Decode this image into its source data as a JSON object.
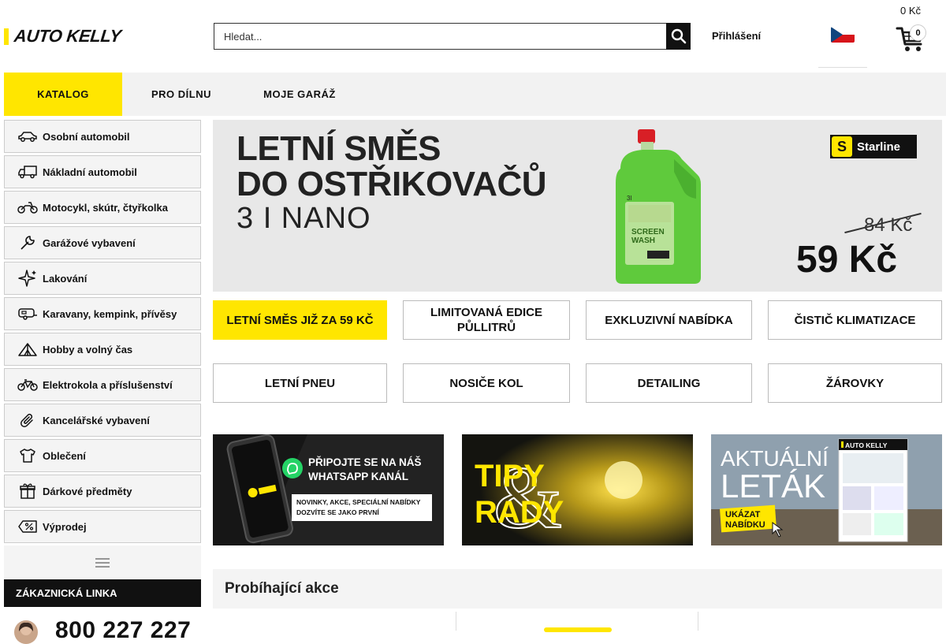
{
  "header": {
    "logo": "AUTO KELLY",
    "search_placeholder": "Hledat...",
    "login_label": "Přihlášení",
    "language_flag": "czech-flag-icon",
    "cart_price": "0 Kč",
    "cart_count": "0"
  },
  "nav": {
    "tabs": [
      {
        "label": "KATALOG",
        "active": true
      },
      {
        "label": "PRO DÍLNU",
        "active": false
      },
      {
        "label": "MOJE GARÁŽ",
        "active": false
      }
    ]
  },
  "sidebar": {
    "items": [
      {
        "label": "Osobní automobil",
        "icon": "car-icon"
      },
      {
        "label": "Nákladní automobil",
        "icon": "truck-icon"
      },
      {
        "label": "Motocykl, skútr, čtyřkolka",
        "icon": "motorcycle-icon"
      },
      {
        "label": "Garážové vybavení",
        "icon": "wrench-icon"
      },
      {
        "label": "Lakování",
        "icon": "sparkle-icon"
      },
      {
        "label": "Karavany, kempink, přívěsy",
        "icon": "caravan-icon"
      },
      {
        "label": "Hobby a volný čas",
        "icon": "tent-icon"
      },
      {
        "label": "Elektrokola a příslušenství",
        "icon": "bicycle-icon"
      },
      {
        "label": "Kancelářské vybavení",
        "icon": "paperclip-icon"
      },
      {
        "label": "Oblečení",
        "icon": "tshirt-icon"
      },
      {
        "label": "Dárkové předměty",
        "icon": "gift-icon"
      },
      {
        "label": "Výprodej",
        "icon": "percent-tag-icon"
      }
    ],
    "more_icon": "hamburger-menu-icon",
    "hotline_label": "ZÁKAZNICKÁ LINKA",
    "phone": "800 227 227"
  },
  "hero": {
    "title_line1": "LETNÍ SMĚS",
    "title_line2": "DO OSTŘIKOVAČŮ",
    "subtitle": "3 I NANO",
    "brand": "Starline",
    "brand_letter": "S",
    "old_price": "84 Kč",
    "new_price": "59 Kč",
    "bottle_label_1": "SCREEN",
    "bottle_label_2": "WASH",
    "bottle_volume": "3l"
  },
  "categories": [
    {
      "label": "LETNÍ SMĚS JIŽ ZA 59 KČ",
      "highlight": true
    },
    {
      "label": "LIMITOVANÁ EDICE PŮLLITRŮ",
      "highlight": false
    },
    {
      "label": "EXKLUZIVNÍ NABÍDKA",
      "highlight": false
    },
    {
      "label": "ČISTIČ KLIMATIZACE",
      "highlight": false
    },
    {
      "label": "LETNÍ PNEU",
      "highlight": false
    },
    {
      "label": "NOSIČE KOL",
      "highlight": false
    },
    {
      "label": "DETAILING",
      "highlight": false
    },
    {
      "label": "ŽÁROVKY",
      "highlight": false
    }
  ],
  "promos": {
    "whatsapp": {
      "title1": "PŘIPOJTE SE NA NÁŠ",
      "title2": "WHATSAPP KANÁL",
      "sub1": "NOVINKY, AKCE, SPECIÁLNÍ NABÍDKY",
      "sub2": "DOZVÍTE SE JAKO PRVNÍ"
    },
    "tips": {
      "line1": "TIPY",
      "amp": "&",
      "line2": "RADY"
    },
    "leaflet": {
      "line1": "AKTUÁLNÍ",
      "line2": "LETÁK",
      "cta1": "UKÁZAT",
      "cta2": "NABÍDKU",
      "brand": "AUTO KELLY"
    }
  },
  "section_title": "Probíhající akce"
}
